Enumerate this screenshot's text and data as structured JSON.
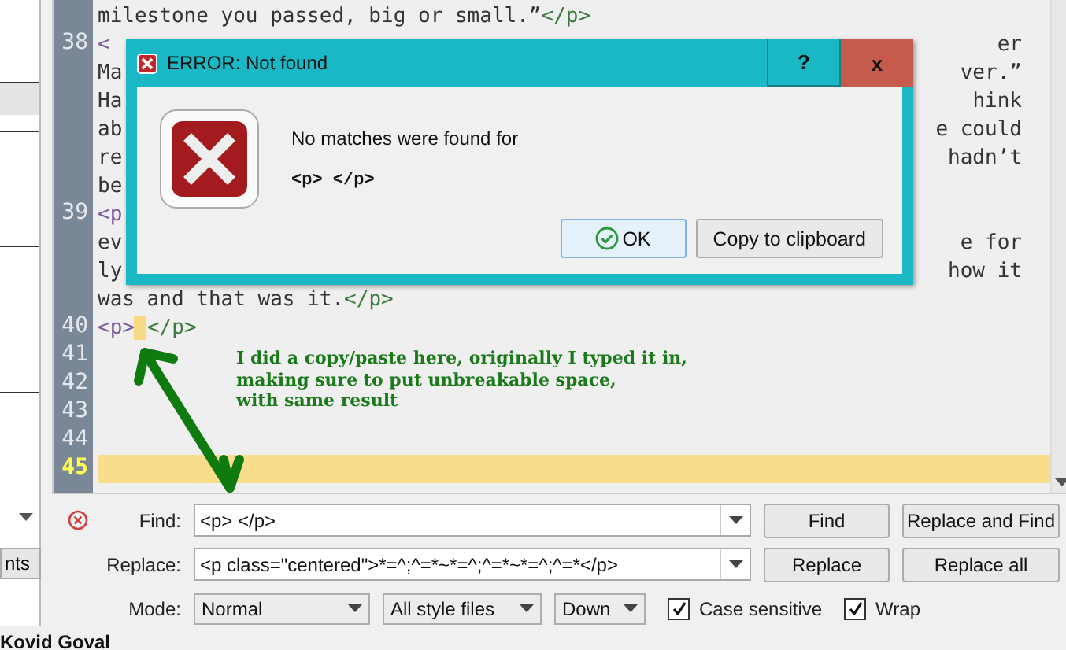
{
  "side_panel": {
    "button": "nts",
    "author": "Kovid Goval"
  },
  "editor": {
    "rows": [
      {
        "left": [
          {
            "kind": "text",
            "text": "milestone you passed, big or small.”"
          },
          {
            "kind": "close-tag",
            "text": "</p>"
          }
        ]
      },
      {
        "number": "38",
        "left": [
          {
            "kind": "open-tag",
            "text": "<"
          }
        ],
        "right": [
          {
            "kind": "text",
            "text": "er"
          }
        ]
      },
      {
        "left": [
          {
            "kind": "text",
            "text": "Ma"
          }
        ],
        "right": [
          {
            "kind": "text",
            "text": "ver.”"
          }
        ]
      },
      {
        "left": [
          {
            "kind": "text",
            "text": "Ha"
          }
        ],
        "right": [
          {
            "kind": "text",
            "text": "hink"
          }
        ]
      },
      {
        "left": [
          {
            "kind": "text",
            "text": "ab"
          }
        ],
        "right": [
          {
            "kind": "text",
            "text": "e could"
          }
        ]
      },
      {
        "left": [
          {
            "kind": "text",
            "text": "re"
          }
        ],
        "right": [
          {
            "kind": "text",
            "text": "hadn’t"
          }
        ]
      },
      {
        "left": [
          {
            "kind": "text",
            "text": "be"
          }
        ]
      },
      {
        "number": "39",
        "left": [
          {
            "kind": "open-tag",
            "text": "<p"
          }
        ]
      },
      {
        "left": [
          {
            "kind": "text",
            "text": "ev"
          }
        ],
        "right": [
          {
            "kind": "text",
            "text": "e for"
          }
        ]
      },
      {
        "left": [
          {
            "kind": "text",
            "text": "ly"
          }
        ],
        "right": [
          {
            "kind": "text",
            "text": "how it"
          }
        ]
      },
      {
        "left": [
          {
            "kind": "text",
            "text": "was and that was it."
          },
          {
            "kind": "close-tag",
            "text": "</p>"
          }
        ]
      },
      {
        "number": "40",
        "left": [
          {
            "kind": "open-tag",
            "text": "<p>"
          },
          {
            "kind": "nbsp-marker"
          },
          {
            "kind": "close-tag",
            "text": "</p>"
          }
        ]
      },
      {
        "number": "41"
      },
      {
        "number": "42"
      },
      {
        "number": "43"
      },
      {
        "number": "44"
      },
      {
        "number": "45",
        "current": true
      }
    ]
  },
  "dialog": {
    "title": "ERROR: Not found",
    "help": "?",
    "close": "x",
    "message": "No matches were found for",
    "query": "<p> </p>",
    "buttons": [
      {
        "label": "OK",
        "default": true
      },
      {
        "label": "Copy to clipboard",
        "default": false
      }
    ]
  },
  "annotation": {
    "text": "I did a copy/paste here, originally I typed it in,\nmaking sure to put unbreakable space,\nwith same result"
  },
  "find_bar": {
    "error": true,
    "find": {
      "label": "Find:",
      "value": "<p> </p>"
    },
    "replace": {
      "label": "Replace:",
      "value": "<p class=\"centered\">*=^;^=*~*=^;^=*~*=^;^=*</p>"
    },
    "buttons": [
      [
        "Find",
        "Replace and Find"
      ],
      [
        "Replace",
        "Replace all"
      ]
    ],
    "mode": {
      "label": "Mode:",
      "value": "Normal"
    },
    "scope": "All style files",
    "direction": "Down",
    "options": [
      {
        "label": "Case sensitive",
        "checked": true
      },
      {
        "label": "Wrap",
        "checked": true
      }
    ]
  }
}
